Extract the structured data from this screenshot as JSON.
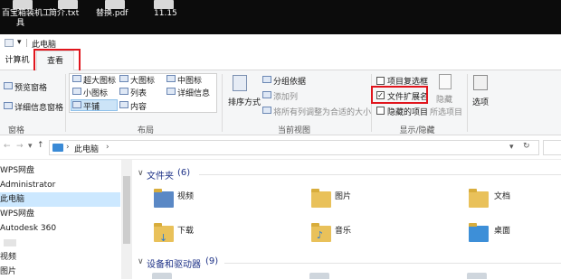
{
  "desktop": {
    "icons": [
      {
        "label_line1": "百宝箱装机工",
        "label_line2": "具"
      },
      {
        "label_line1": "简介.txt",
        "label_line2": ""
      },
      {
        "label_line1": "替换.pdf",
        "label_line2": ""
      },
      {
        "label_line1": "11.15",
        "label_line2": ""
      }
    ]
  },
  "titlebar": {
    "title": "此电脑",
    "qa_arrow": "▾"
  },
  "tabs": {
    "computer": "计算机",
    "view": "查看"
  },
  "ribbon": {
    "preview_pane": "预览窗格",
    "details_pane": "详细信息窗格",
    "panes_group": "窗格",
    "layout": {
      "xl_icons": "超大图标",
      "large_icons": "大图标",
      "medium_icons": "中图标",
      "small_icons": "小图标",
      "list": "列表",
      "details": "详细信息",
      "tiles": "平铺",
      "content": "内容"
    },
    "layout_group": "布局",
    "sort_by": "排序方式",
    "group_by": "分组依据",
    "add_columns": "添加列",
    "size_all_columns": "将所有列调整为合适的大小",
    "current_view_group": "当前视图",
    "item_checkboxes": "项目复选框",
    "file_extensions": "文件扩展名",
    "hidden_items": "隐藏的项目",
    "hide_selected": "隐藏",
    "hide_selected_2": "所选项目",
    "options": "选项",
    "show_hide_group": "显示/隐藏",
    "file_extensions_checked": true
  },
  "address": {
    "path": "此电脑",
    "separator": "›"
  },
  "nav": {
    "items": [
      "WPS网盘",
      "Administrator",
      "此电脑",
      "WPS网盘",
      "Autodesk 360",
      "",
      "视频",
      "图片"
    ]
  },
  "content": {
    "folders_title": "文件夹",
    "folders_count": "(6)",
    "folders": [
      "视频",
      "图片",
      "文档",
      "下载",
      "音乐",
      "桌面"
    ],
    "devices_title": "设备和驱动器",
    "devices_count": "(9)"
  },
  "colors": {
    "accent_red": "#e0151d",
    "folder": "#e9c15a",
    "section_blue": "#1e3287",
    "selection": "#cce8ff"
  }
}
